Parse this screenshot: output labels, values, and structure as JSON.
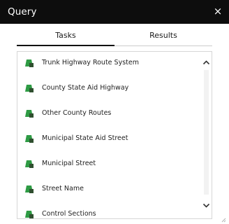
{
  "header": {
    "title": "Query",
    "close_label": "×"
  },
  "tabs": [
    {
      "label": "Tasks",
      "active": true
    },
    {
      "label": "Results",
      "active": false
    }
  ],
  "tasks": [
    {
      "label": "Trunk Highway Route System",
      "icon": "query-task-icon"
    },
    {
      "label": "County State Aid Highway",
      "icon": "query-task-icon"
    },
    {
      "label": "Other County Routes",
      "icon": "query-task-icon"
    },
    {
      "label": "Municipal State Aid Street",
      "icon": "query-task-icon"
    },
    {
      "label": "Municipal Street",
      "icon": "query-task-icon"
    },
    {
      "label": "Street Name",
      "icon": "query-task-icon"
    },
    {
      "label": "Control Sections",
      "icon": "query-task-icon"
    }
  ],
  "colors": {
    "header_bg": "#0d0d0d",
    "icon_green": "#2e9b44",
    "icon_dark": "#2f4f2f"
  }
}
